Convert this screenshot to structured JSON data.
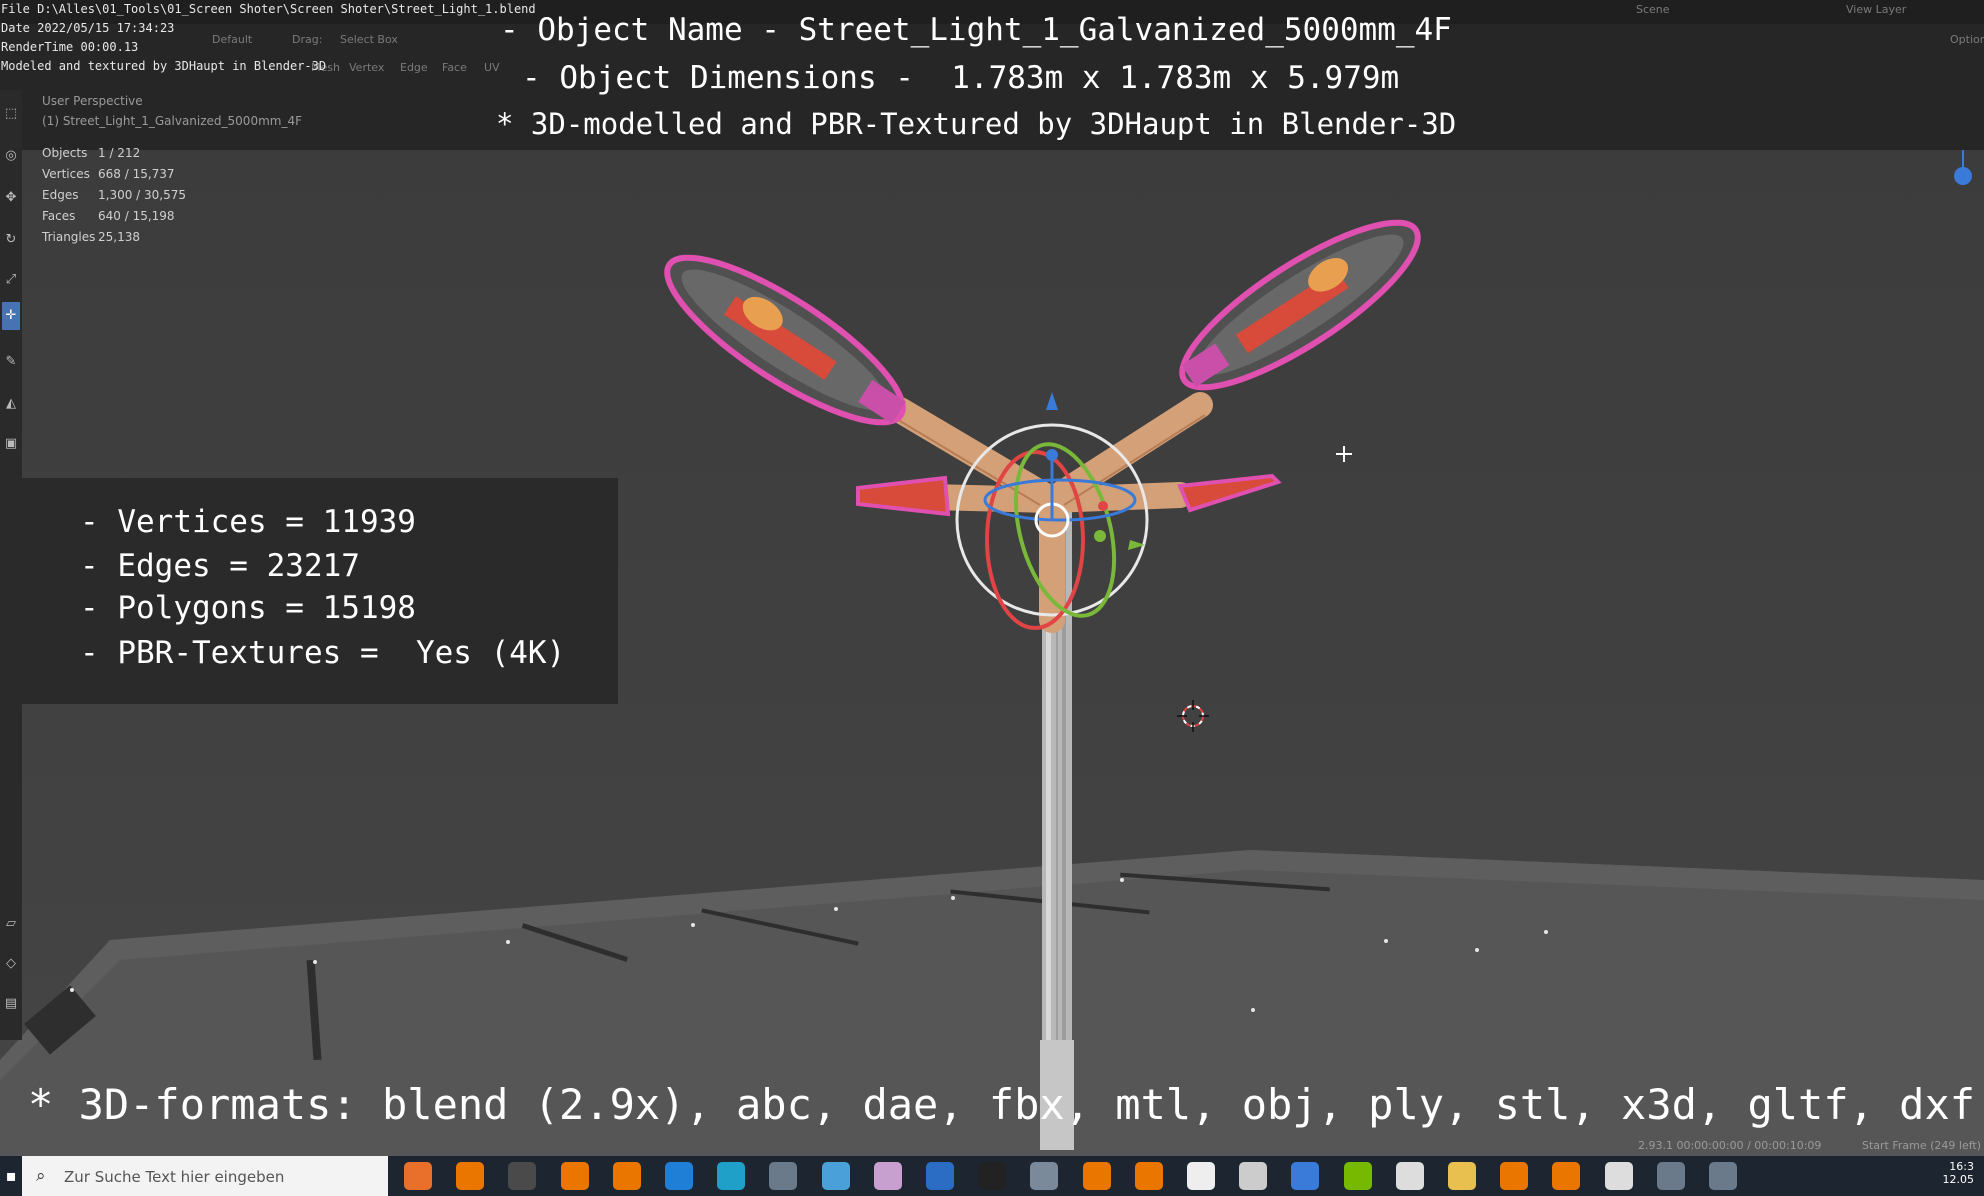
{
  "header": {
    "file_line": "File D:\\Alles\\01_Tools\\01_Screen Shoter\\Screen Shoter\\Street_Light_1.blend",
    "date_line": "Date 2022/05/15 17:34:23",
    "render_line": "RenderTime 00:00.13",
    "credit_line": "Modeled and textured by 3DHaupt in Blender-3D",
    "scene_label": "Scene",
    "view_layer_label": "View Layer",
    "options_label": "Options",
    "orientation_value": "Default",
    "drag_label": "Drag:",
    "select_mode_value": "Select Box",
    "menu_items": [
      "Mesh",
      "Vertex",
      "Edge",
      "Face",
      "UV"
    ]
  },
  "overlay": {
    "object_name": "- Object Name - Street_Light_1_Galvanized_5000mm_4F",
    "object_dimensions": "- Object Dimensions -  1.783m x 1.783m x 5.979m",
    "credit": "* 3D-modelled and PBR-Textured by 3DHaupt in Blender-3D"
  },
  "viewport": {
    "perspective_label": "User Perspective",
    "object_label": "(1) Street_Light_1_Galvanized_5000mm_4F",
    "stats": [
      {
        "key": "Objects",
        "value": "1 / 212"
      },
      {
        "key": "Vertices",
        "value": "668 / 15,737"
      },
      {
        "key": "Edges",
        "value": "1,300 / 30,575"
      },
      {
        "key": "Faces",
        "value": "640 / 15,198"
      },
      {
        "key": "Triangles",
        "value": "25,138"
      }
    ]
  },
  "info_panel": {
    "lines": [
      "- Vertices = 11939",
      "- Edges = 23217",
      "- Polygons = 15198",
      "- PBR-Textures =  Yes (4K)"
    ]
  },
  "formats_line": "* 3D-formats: blend (2.9x), abc, dae, fbx, mtl, obj, ply, stl, x3d, gltf, dxf",
  "status": {
    "version_time": "2.93.1  00:00:00:00 / 00:00:10:09",
    "start_frame": "Start Frame (249 left)"
  },
  "taskbar": {
    "search_placeholder": "Zur Suche Text hier eingeben",
    "clock_time": "16:3",
    "clock_date": "12.05",
    "apps": [
      "firefox-icon",
      "blender-icon",
      "obs-icon",
      "blender-icon",
      "blender-icon",
      "mail-icon",
      "edge-icon",
      "app-icon",
      "notes-icon",
      "paint-icon",
      "word-icon",
      "terminal-icon",
      "plane-icon",
      "blender-icon",
      "blender-icon",
      "panda-icon",
      "cube-icon",
      "calendar-icon",
      "nvidia-icon",
      "clock-icon",
      "folder-icon",
      "blender-icon",
      "blender-icon",
      "settings-icon",
      "app-icon",
      "app-icon"
    ]
  },
  "colors": {
    "selection_outline": "#e050b0",
    "lamp_arm": "#d9a37a",
    "lamp_head_red": "#d84a3a",
    "lamp_bulb": "#e8a050",
    "pole": "#b9b9b9",
    "gizmo_x": "#e04444",
    "gizmo_y": "#7ab83a",
    "gizmo_z": "#3a7ad8"
  }
}
